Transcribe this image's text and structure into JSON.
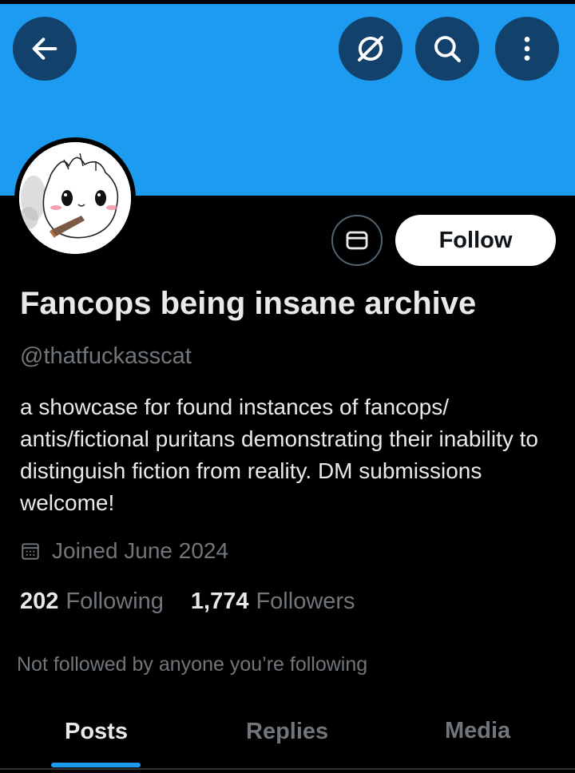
{
  "header": {
    "back_icon": "arrow-left-icon",
    "grok_icon": "slashed-circle-icon",
    "search_icon": "search-icon",
    "more_icon": "vertical-dots-icon",
    "banner_color": "#1d9bf0"
  },
  "profile": {
    "avatar_icon": "cat-avatar",
    "display_name": "Fancops being insane archive",
    "handle": "@thatfuckasscat",
    "bio": "a showcase for found instances of fancops/ antis/fictional puritans demonstrating their inability to distinguish fiction from reality. DM submissions welcome!",
    "joined": "Joined June 2024",
    "following_count": "202",
    "following_label": "Following",
    "followers_count": "1,774",
    "followers_label": "Followers",
    "not_followed": "Not followed by anyone you’re following"
  },
  "actions": {
    "message_icon": "envelope-icon",
    "follow_label": "Follow"
  },
  "tabs": [
    {
      "label": "Posts",
      "active": true
    },
    {
      "label": "Replies",
      "active": false
    },
    {
      "label": "Media",
      "active": false
    }
  ],
  "colors": {
    "accent": "#1d9bf0",
    "secondary_text": "#71767b",
    "primary_text": "#e7e9ea"
  }
}
